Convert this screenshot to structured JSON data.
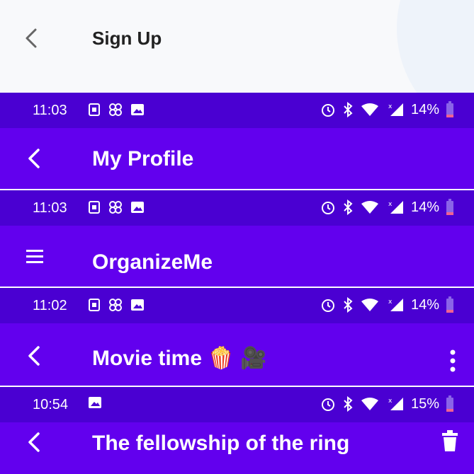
{
  "signup": {
    "title": "Sign Up"
  },
  "profile": {
    "status_time": "11:03",
    "status_battery": "14%",
    "title": "My Profile"
  },
  "organize": {
    "status_time": "11:03",
    "status_battery": "14%",
    "title": "OrganizeMe"
  },
  "movie": {
    "status_time": "11:02",
    "status_battery": "14%",
    "title": "Movie time 🍿 🎥"
  },
  "fellowship": {
    "status_time": "10:54",
    "status_battery": "15%",
    "title": "The fellowship of the ring"
  },
  "colors": {
    "status_bar": "#4a00d2",
    "app_bar": "#6200ee",
    "battery_low": "#f06292"
  }
}
